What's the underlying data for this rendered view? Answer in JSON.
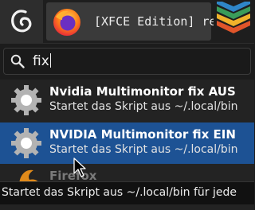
{
  "panel": {
    "taskbar_item_label": "[XFCE Edition] re..."
  },
  "search": {
    "query": "fix"
  },
  "results": [
    {
      "title": "Nvidia Multimonitor fix AUS",
      "description": "Startet das Skript aus ~/.local/bin",
      "selected": false
    },
    {
      "title": "NVIDIA Multimonitor fix EIN",
      "description": "Startet das Skript aus ~/.local/bin",
      "selected": true
    },
    {
      "title": "Firefox",
      "partial": true
    }
  ],
  "tooltip": {
    "text": "Startet das Skript aus ~/.local/bin für jede"
  },
  "colors": {
    "selection": "#1d5294",
    "background": "#232323"
  }
}
